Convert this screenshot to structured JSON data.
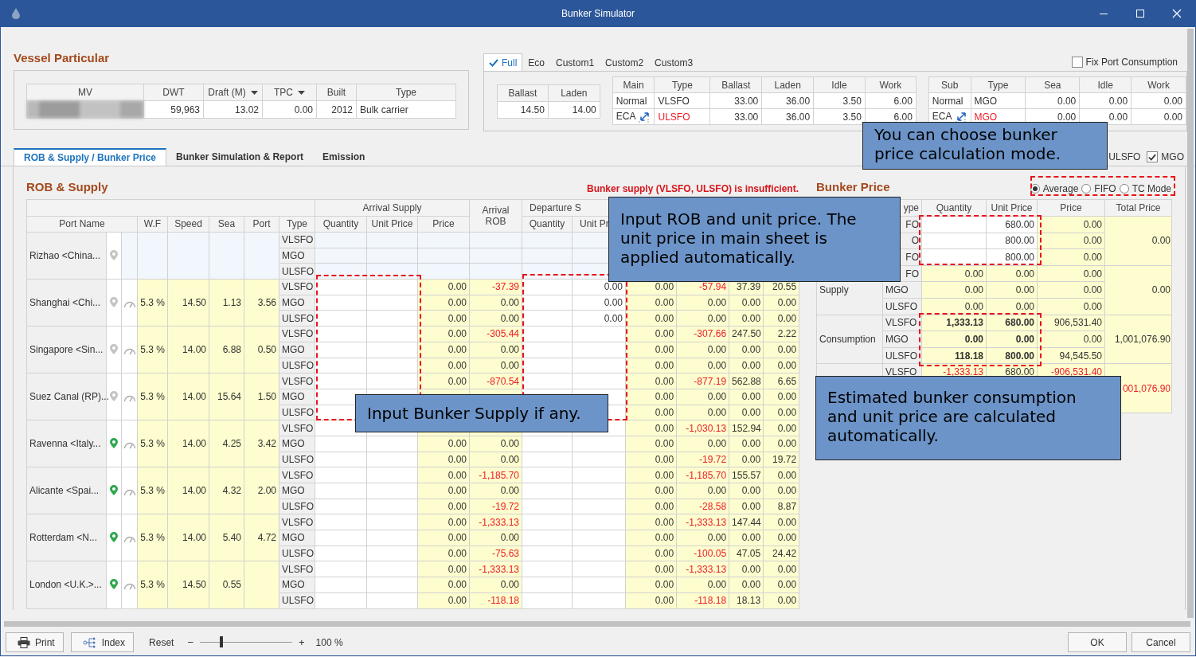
{
  "window": {
    "title": "Bunker Simulator"
  },
  "vessel_particular": {
    "title": "Vessel Particular",
    "columns": [
      {
        "label": "MV",
        "redacted": true
      },
      {
        "label": "DWT",
        "dropdown": false
      },
      {
        "label": "Draft (M)",
        "dropdown": true
      },
      {
        "label": "TPC",
        "dropdown": true
      },
      {
        "label": "Built",
        "dropdown": false
      },
      {
        "label": "Type",
        "dropdown": false
      }
    ],
    "values": [
      "59,963",
      "13.02",
      "0.00",
      "2012",
      "Bulk carrier"
    ]
  },
  "speed_profiles": {
    "tabs": [
      {
        "label": "Full",
        "selected": true
      },
      {
        "label": "Eco",
        "selected": false
      },
      {
        "label": "Custom1",
        "selected": false
      },
      {
        "label": "Custom2",
        "selected": false
      },
      {
        "label": "Custom3",
        "selected": false
      }
    ],
    "fix_port_consumption": {
      "label": "Fix Port Consumption",
      "checked": false
    },
    "speed_table": {
      "columns": [
        "Ballast",
        "Laden"
      ],
      "values": [
        "14.50",
        "14.00"
      ]
    },
    "main_table": {
      "columns": [
        "Main",
        "Type",
        "Ballast",
        "Laden",
        "Idle",
        "Work"
      ],
      "rows": [
        {
          "mode": "Normal",
          "eca": false,
          "fuel": "VLSFO",
          "alert": false,
          "values": [
            "33.00",
            "36.00",
            "3.50",
            "6.00"
          ]
        },
        {
          "mode": "ECA",
          "eca": true,
          "fuel": "ULSFO",
          "alert": true,
          "values": [
            "33.00",
            "36.00",
            "3.50",
            "6.00"
          ]
        }
      ]
    },
    "sub_table": {
      "columns": [
        "Sub",
        "Type",
        "Sea",
        "Idle",
        "Work"
      ],
      "rows": [
        {
          "mode": "Normal",
          "eca": false,
          "fuel": "MGO",
          "alert": false,
          "values": [
            "0.00",
            "0.00",
            "0.00"
          ]
        },
        {
          "mode": "ECA",
          "eca": true,
          "fuel": "MGO",
          "alert": true,
          "values": [
            "0.00",
            "0.00",
            "0.00"
          ]
        }
      ]
    }
  },
  "tabs": [
    {
      "label": "ROB & Supply / Bunker Price",
      "selected": true
    },
    {
      "label": "Bunker Simulation & Report",
      "selected": false
    },
    {
      "label": "Emission",
      "selected": false
    }
  ],
  "fuel_filters": [
    {
      "label": "ULSFO"
    },
    {
      "label": "MGO",
      "checked": true
    }
  ],
  "rob_supply": {
    "title": "ROB & Supply",
    "warning": "Bunker supply (VLSFO, ULSFO) is insufficient.",
    "arrival_supply": "Arrival Supply",
    "arrival_rob": "Arrival\nROB",
    "departure_supply": "Departure S",
    "columns": [
      "Port Name",
      "W.F",
      "Speed",
      "Sea",
      "Port",
      "Type",
      "Quantity",
      "Unit Price",
      "Price",
      "Quantity",
      "Unit Pr"
    ],
    "ports": [
      {
        "name": "Rizhao <China...",
        "color": "#c4c4c4",
        "gauge": false,
        "departure_port": true,
        "fuels": [
          {
            "type": "VLSFO"
          },
          {
            "type": "MGO"
          },
          {
            "type": "ULSFO"
          }
        ]
      },
      {
        "name": "Shanghai <Chi...",
        "color": "#c4c4c4",
        "gauge": true,
        "departure_port": false,
        "wf": "5.3 %",
        "speed": "14.50",
        "sea": "1.13",
        "port": "3.56",
        "fuels": [
          {
            "type": "VLSFO",
            "cells": [
              null,
              null,
              "0.00",
              {
                "text": "-37.39",
                "alert": true
              },
              null,
              "0.00",
              "0.00",
              {
                "text": "-57.94",
                "alert": true
              },
              "37.39",
              "20.55"
            ]
          },
          {
            "type": "MGO",
            "cells": [
              null,
              null,
              "0.00",
              "0.00",
              null,
              "0.00",
              "0.00",
              "0.00",
              "0.00",
              "0.00"
            ]
          },
          {
            "type": "ULSFO",
            "cells": [
              null,
              null,
              "0.00",
              "0.00",
              null,
              "0.00",
              "0.00",
              "0.00",
              "0.00",
              "0.00"
            ]
          }
        ]
      },
      {
        "name": "Singapore <Sin...",
        "color": "#c4c4c4",
        "gauge": true,
        "departure_port": false,
        "wf": "5.3 %",
        "speed": "14.00",
        "sea": "6.88",
        "port": "0.50",
        "fuels": [
          {
            "type": "VLSFO",
            "cells": [
              null,
              null,
              "0.00",
              {
                "text": "-305.44",
                "alert": true
              },
              null,
              null,
              "0.00",
              {
                "text": "-307.66",
                "alert": true
              },
              "247.50",
              "2.22"
            ]
          },
          {
            "type": "MGO",
            "cells": [
              null,
              null,
              "0.00",
              "0.00",
              null,
              null,
              "0.00",
              "0.00",
              "0.00",
              "0.00"
            ]
          },
          {
            "type": "ULSFO",
            "cells": [
              null,
              null,
              "0.00",
              "0.00",
              null,
              null,
              "0.00",
              "0.00",
              "0.00",
              "0.00"
            ]
          }
        ]
      },
      {
        "name": "Suez Canal (RP)...",
        "color": "#c4c4c4",
        "gauge": true,
        "departure_port": false,
        "wf": "5.3 %",
        "speed": "14.00",
        "sea": "15.64",
        "port": "1.50",
        "fuels": [
          {
            "type": "VLSFO",
            "cells": [
              null,
              null,
              "0.00",
              {
                "text": "-870.54",
                "alert": true
              },
              null,
              null,
              "0.00",
              {
                "text": "-877.19",
                "alert": true
              },
              "562.88",
              "6.65"
            ]
          },
          {
            "type": "MGO",
            "cells": [
              null,
              null,
              null,
              null,
              null,
              null,
              "0.00",
              "0.00",
              "0.00",
              "0.00"
            ]
          },
          {
            "type": "ULSFO",
            "cells": [
              null,
              null,
              null,
              null,
              null,
              null,
              "0.00",
              "0.00",
              "0.00",
              "0.00"
            ]
          }
        ]
      },
      {
        "name": "Ravenna <Italy...",
        "color": "#2fa84f",
        "gauge": true,
        "departure_port": false,
        "wf": "5.3 %",
        "speed": "14.00",
        "sea": "4.25",
        "port": "3.42",
        "fuels": [
          {
            "type": "VLSFO",
            "cells": [
              null,
              null,
              null,
              null,
              null,
              null,
              "0.00",
              {
                "text": "-1,030.13",
                "alert": true
              },
              "152.94",
              "0.00"
            ]
          },
          {
            "type": "MGO",
            "cells": [
              null,
              null,
              "0.00",
              "0.00",
              null,
              null,
              "0.00",
              "0.00",
              "0.00",
              "0.00"
            ]
          },
          {
            "type": "ULSFO",
            "cells": [
              null,
              null,
              "0.00",
              "0.00",
              null,
              null,
              "0.00",
              {
                "text": "-19.72",
                "alert": true
              },
              "0.00",
              "19.72"
            ]
          }
        ]
      },
      {
        "name": "Alicante <Spai...",
        "color": "#2fa84f",
        "gauge": true,
        "departure_port": false,
        "wf": "5.3 %",
        "speed": "14.00",
        "sea": "4.32",
        "port": "2.00",
        "fuels": [
          {
            "type": "VLSFO",
            "cells": [
              null,
              null,
              "0.00",
              {
                "text": "-1,185.70",
                "alert": true
              },
              null,
              null,
              "0.00",
              {
                "text": "-1,185.70",
                "alert": true
              },
              "155.57",
              "0.00"
            ]
          },
          {
            "type": "MGO",
            "cells": [
              null,
              null,
              "0.00",
              "0.00",
              null,
              null,
              "0.00",
              "0.00",
              "0.00",
              "0.00"
            ]
          },
          {
            "type": "ULSFO",
            "cells": [
              null,
              null,
              "0.00",
              {
                "text": "-19.72",
                "alert": true
              },
              null,
              null,
              "0.00",
              {
                "text": "-28.58",
                "alert": true
              },
              "0.00",
              "8.87"
            ]
          }
        ]
      },
      {
        "name": "Rotterdam <N...",
        "color": "#2fa84f",
        "gauge": true,
        "departure_port": false,
        "wf": "5.3 %",
        "speed": "14.00",
        "sea": "5.40",
        "port": "4.72",
        "fuels": [
          {
            "type": "VLSFO",
            "cells": [
              null,
              null,
              "0.00",
              {
                "text": "-1,333.13",
                "alert": true
              },
              null,
              null,
              "0.00",
              {
                "text": "-1,333.13",
                "alert": true
              },
              "147.44",
              "0.00"
            ]
          },
          {
            "type": "MGO",
            "cells": [
              null,
              null,
              "0.00",
              "0.00",
              null,
              null,
              "0.00",
              "0.00",
              "0.00",
              "0.00"
            ]
          },
          {
            "type": "ULSFO",
            "cells": [
              null,
              null,
              "0.00",
              {
                "text": "-75.63",
                "alert": true
              },
              null,
              null,
              "0.00",
              {
                "text": "-100.05",
                "alert": true
              },
              "47.05",
              "24.42"
            ]
          }
        ]
      },
      {
        "name": "London <U.K.>...",
        "color": "#2fa84f",
        "gauge": true,
        "departure_port": false,
        "wf": "5.3 %",
        "speed": "14.50",
        "sea": "0.55",
        "fuels": [
          {
            "type": "VLSFO",
            "cells": [
              null,
              null,
              "0.00",
              {
                "text": "-1,333.13",
                "alert": true
              },
              null,
              null,
              "0.00",
              {
                "text": "-1,333.13",
                "alert": true
              },
              "0.00",
              "0.00"
            ]
          },
          {
            "type": "MGO",
            "cells": [
              null,
              null,
              "0.00",
              "0.00",
              null,
              null,
              "0.00",
              "0.00",
              "0.00",
              "0.00"
            ]
          },
          {
            "type": "ULSFO",
            "cells": [
              null,
              null,
              "0.00",
              {
                "text": "-118.18",
                "alert": true
              },
              null,
              null,
              "0.00",
              {
                "text": "-118.18",
                "alert": true
              },
              "18.13",
              "0.00"
            ]
          }
        ]
      }
    ]
  },
  "bunker_price": {
    "title": "Bunker Price",
    "modes": [
      {
        "label": "Average",
        "selected": true
      },
      {
        "label": "FIFO",
        "selected": false
      },
      {
        "label": "TC Mode",
        "selected": false
      }
    ],
    "columns": [
      {
        "label": "ype",
        "partly_hidden": true
      },
      {
        "label": "Quantity"
      },
      {
        "label": "Unit Price"
      },
      {
        "label": "Price"
      },
      {
        "label": "Total Price"
      }
    ],
    "groups": [
      {
        "input": true,
        "rows": [
          {
            "type": "FO",
            "partly_hidden": true,
            "cells": [
              null,
              "680.00",
              "0.00"
            ]
          },
          {
            "type": "O",
            "partly_hidden": true,
            "cells": [
              null,
              "800.00",
              "0.00"
            ]
          },
          {
            "type": "FO",
            "partly_hidden": true,
            "cells": [
              null,
              "800.00",
              "0.00"
            ]
          }
        ],
        "total": "0.00"
      },
      {
        "label": "Supply",
        "rows": [
          {
            "type": "FO",
            "partly_hidden": true,
            "cells": [
              "0.00",
              "0.00",
              "0.00"
            ]
          },
          {
            "type": "MGO",
            "cells": [
              "0.00",
              "0.00",
              "0.00"
            ]
          },
          {
            "type": "ULSFO",
            "cells": [
              "0.00",
              "0.00",
              "0.00"
            ]
          }
        ],
        "total": "0.00"
      },
      {
        "label": "Consumption",
        "emphasis": true,
        "rows": [
          {
            "type": "VLSFO",
            "cells": [
              "1,333.13",
              "680.00",
              "906,531.40"
            ]
          },
          {
            "type": "MGO",
            "cells": [
              "0.00",
              "0.00",
              "0.00"
            ]
          },
          {
            "type": "ULSFO",
            "cells": [
              "118.18",
              "800.00",
              "94,545.50"
            ]
          }
        ],
        "total": "1,001,076.90"
      },
      {
        "rows": [
          {
            "type": "VLSFO",
            "cells": [
              {
                "text": "-1,333.13",
                "alert": true
              },
              "680.00",
              {
                "text": "-906,531.40",
                "alert": true
              }
            ]
          }
        ],
        "total": {
          "text": "001,076.90",
          "alert": true
        }
      }
    ]
  },
  "callouts": [
    {
      "text": "You can choose bunker price calculation mode."
    },
    {
      "text": "Input ROB and unit price. The unit price in main sheet is applied automatically."
    },
    {
      "text": "Input Bunker Supply if any."
    },
    {
      "text": "Estimated bunker consumption and unit price are calculated automatically."
    }
  ],
  "footer": {
    "buttons": [
      {
        "kind": "print",
        "label": "Print"
      },
      {
        "kind": "index",
        "label": "Index"
      }
    ],
    "reset": "Reset",
    "zoom": {
      "minus": "−",
      "plus": "+",
      "level": 0.23,
      "reading": "100 %"
    },
    "dialog_buttons": [
      "OK",
      "Cancel"
    ]
  }
}
